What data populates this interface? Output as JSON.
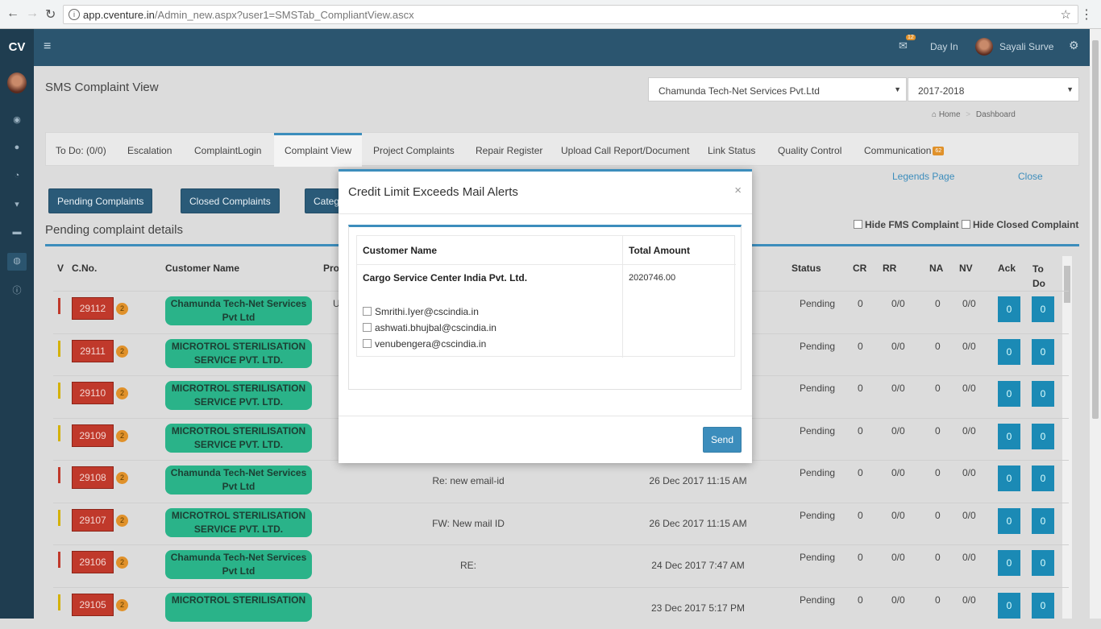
{
  "browser": {
    "back": "←",
    "forward": "→",
    "reload": "↻",
    "info": "i",
    "url_host": "app.cventure.in",
    "url_path": "/Admin_new.aspx?user1=SMSTab_CompliantView.ascx",
    "star": "☆",
    "menu": "⋮"
  },
  "topbar": {
    "logo": "CV",
    "menu_icon": "≡",
    "notif_count": "12",
    "day_in": "Day In",
    "user_name": "Sayali Surve",
    "settings_icon": "⚙"
  },
  "sidebar_icons": [
    "dashboard-icon",
    "user-icon",
    "chart-icon",
    "cart-icon",
    "card-icon",
    "globe-icon",
    "info-icon"
  ],
  "page": {
    "title": "SMS Complaint View",
    "company_select": "Chamunda Tech-Net Services Pvt.Ltd",
    "year_select": "2017-2018",
    "caret": "▼",
    "breadcrumb_home": "Home",
    "breadcrumb_sep": ">",
    "breadcrumb_current": "Dashboard",
    "legends_link": "Legends Page",
    "close_link": "Close",
    "section_title": "Pending complaint details",
    "hide_fms": "Hide FMS Complaint",
    "hide_closed": "Hide Closed Complaint"
  },
  "tabs": [
    {
      "label": "To Do: (0/0)"
    },
    {
      "label": "Escalation"
    },
    {
      "label": "ComplaintLogin"
    },
    {
      "label": "Complaint View"
    },
    {
      "label": "Project Complaints"
    },
    {
      "label": "Repair Register"
    },
    {
      "label": "Upload Call Report/Document"
    },
    {
      "label": "Link Status"
    },
    {
      "label": "Quality Control"
    },
    {
      "label": "Communication"
    }
  ],
  "communication_badge": "62",
  "buttons": {
    "pending": "Pending Complaints",
    "closed": "Closed Complaints",
    "category": "Categ"
  },
  "table_headers": {
    "v": "V",
    "cno": "C.No.",
    "customer": "Customer Name",
    "pro": "Pro",
    "status": "Status",
    "cr": "CR",
    "rr": "RR",
    "na": "NA",
    "nv": "NV",
    "ack": "Ack",
    "todo": "To Do"
  },
  "rows": [
    {
      "cno": "29112",
      "badge": "2",
      "customer": "Chamunda Tech-Net Services Pvt Ltd",
      "subject": "U",
      "date": "",
      "status": "Pending",
      "cr": "0",
      "rr": "0/0",
      "na": "0",
      "nv": "0/0",
      "ack": "0",
      "todo": "0",
      "vcolor": "#c0392b"
    },
    {
      "cno": "29111",
      "badge": "2",
      "customer": "MICROTROL STERILISATION SERVICE PVT. LTD.",
      "subject": "",
      "date": "",
      "status": "Pending",
      "cr": "0",
      "rr": "0/0",
      "na": "0",
      "nv": "0/0",
      "ack": "0",
      "todo": "0",
      "vcolor": "#d4b106"
    },
    {
      "cno": "29110",
      "badge": "2",
      "customer": "MICROTROL STERILISATION SERVICE PVT. LTD.",
      "subject": "",
      "date": "",
      "status": "Pending",
      "cr": "0",
      "rr": "0/0",
      "na": "0",
      "nv": "0/0",
      "ack": "0",
      "todo": "0",
      "vcolor": "#d4b106"
    },
    {
      "cno": "29109",
      "badge": "2",
      "customer": "MICROTROL STERILISATION SERVICE PVT. LTD.",
      "subject": "",
      "date": "",
      "status": "Pending",
      "cr": "0",
      "rr": "0/0",
      "na": "0",
      "nv": "0/0",
      "ack": "0",
      "todo": "0",
      "vcolor": "#d4b106"
    },
    {
      "cno": "29108",
      "badge": "2",
      "customer": "Chamunda Tech-Net Services Pvt Ltd",
      "subject": "Re: new email-id",
      "date": "26 Dec 2017 11:15 AM",
      "status": "Pending",
      "cr": "0",
      "rr": "0/0",
      "na": "0",
      "nv": "0/0",
      "ack": "0",
      "todo": "0",
      "vcolor": "#c0392b"
    },
    {
      "cno": "29107",
      "badge": "2",
      "customer": "MICROTROL STERILISATION SERVICE PVT. LTD.",
      "subject": "FW: New mail ID",
      "date": "26 Dec 2017 11:15 AM",
      "status": "Pending",
      "cr": "0",
      "rr": "0/0",
      "na": "0",
      "nv": "0/0",
      "ack": "0",
      "todo": "0",
      "vcolor": "#d4b106"
    },
    {
      "cno": "29106",
      "badge": "2",
      "customer": "Chamunda Tech-Net Services Pvt Ltd",
      "subject": "RE:",
      "date": "24 Dec 2017 7:47 AM",
      "status": "Pending",
      "cr": "0",
      "rr": "0/0",
      "na": "0",
      "nv": "0/0",
      "ack": "0",
      "todo": "0",
      "vcolor": "#c0392b"
    },
    {
      "cno": "29105",
      "badge": "2",
      "customer": "MICROTROL STERILISATION",
      "subject": "",
      "date": "23 Dec 2017 5:17 PM",
      "status": "Pending",
      "cr": "0",
      "rr": "0/0",
      "na": "0",
      "nv": "0/0",
      "ack": "0",
      "todo": "0",
      "vcolor": "#d4b106"
    }
  ],
  "modal": {
    "title": "Credit Limit Exceeds Mail Alerts",
    "close": "×",
    "col_customer": "Customer Name",
    "col_amount": "Total Amount",
    "customer": "Cargo Service Center India Pvt. Ltd.",
    "amount": "2020746.00",
    "emails": [
      "Smrithi.Iyer@cscindia.in",
      "ashwati.bhujbal@cscindia.in",
      "venubengera@cscindia.in"
    ],
    "send": "Send"
  }
}
